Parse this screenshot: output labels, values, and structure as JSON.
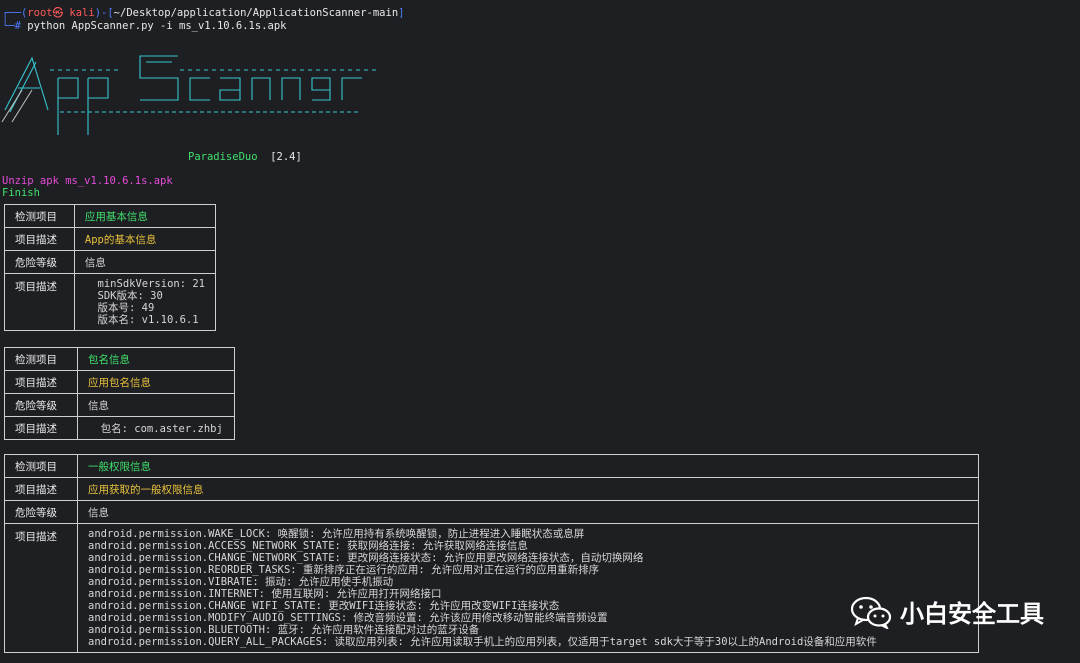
{
  "terminal": {
    "prompt_open": "┌──(",
    "prompt_user": "root㉿ kali",
    "prompt_mid": ")-[",
    "prompt_path": "~/Desktop/application/ApplicationScanner-main",
    "prompt_close": "]",
    "prompt_hash": "└─# ",
    "command": "python AppScanner.py -i ms_v1.10.6.1s.apk",
    "banner_author": "ParadiseDuo",
    "banner_version": "[2.4]",
    "unzip_msg": "Unzip apk ms_v1.10.6.1s.apk",
    "finish_msg": "Finish"
  },
  "tables": [
    {
      "rows": [
        {
          "key": "检测项目",
          "value": "应用基本信息",
          "tone": "green"
        },
        {
          "key": "项目描述",
          "value": "App的基本信息",
          "tone": "yellow"
        },
        {
          "key": "危险等级",
          "value": "信息",
          "tone": "white"
        }
      ],
      "detail_key": "项目描述",
      "detail_lines": [
        "  minSdkVersion: 21",
        "  SDK版本: 30",
        "  版本号: 49",
        "  版本名: v1.10.6.1"
      ]
    },
    {
      "rows": [
        {
          "key": "检测项目",
          "value": "包名信息",
          "tone": "green"
        },
        {
          "key": "项目描述",
          "value": "应用包名信息",
          "tone": "yellow"
        },
        {
          "key": "危险等级",
          "value": "信息",
          "tone": "white"
        }
      ],
      "detail_key": "项目描述",
      "detail_lines": [
        "  包名: com.aster.zhbj"
      ]
    },
    {
      "rows": [
        {
          "key": "检测项目",
          "value": "一般权限信息",
          "tone": "green"
        },
        {
          "key": "项目描述",
          "value": "应用获取的一般权限信息",
          "tone": "yellow"
        },
        {
          "key": "危险等级",
          "value": "信息",
          "tone": "white"
        }
      ],
      "detail_key": "项目描述",
      "detail_lines": [
        "android.permission.WAKE_LOCK: 唤醒锁: 允许应用持有系统唤醒锁，防止进程进入睡眠状态或息屏",
        "android.permission.ACCESS_NETWORK_STATE: 获取网络连接: 允许获取网络连接信息",
        "android.permission.CHANGE_NETWORK_STATE: 更改网络连接状态: 允许应用更改网络连接状态，自动切换网络",
        "android.permission.REORDER_TASKS: 重新排序正在运行的应用: 允许应用对正在运行的应用重新排序",
        "android.permission.VIBRATE: 振动: 允许应用使手机振动",
        "android.permission.INTERNET: 使用互联网: 允许应用打开网络接口",
        "android.permission.CHANGE_WIFI_STATE: 更改WIFI连接状态: 允许应用改变WIFI连接状态",
        "android.permission.MODIFY_AUDIO_SETTINGS: 修改音频设置: 允许该应用修改移动智能终端音频设置",
        "android.permission.BLUETOOTH: 蓝牙: 允许应用软件连接配对过的蓝牙设备",
        "android.permission.QUERY_ALL_PACKAGES: 读取应用列表: 允许应用读取手机上的应用列表，仅适用于target sdk大于等于30以上的Android设备和应用软件"
      ]
    }
  ],
  "watermark": {
    "text": "小白安全工具",
    "icon": "wechat-icon"
  },
  "colors": {
    "background": "#1e1f22",
    "prompt_blue": "#4f7cff",
    "accent_green": "#3fe06c",
    "accent_yellow": "#e8c23d",
    "accent_magenta": "#e64bd9",
    "banner_cyan": "#35c7d0"
  }
}
